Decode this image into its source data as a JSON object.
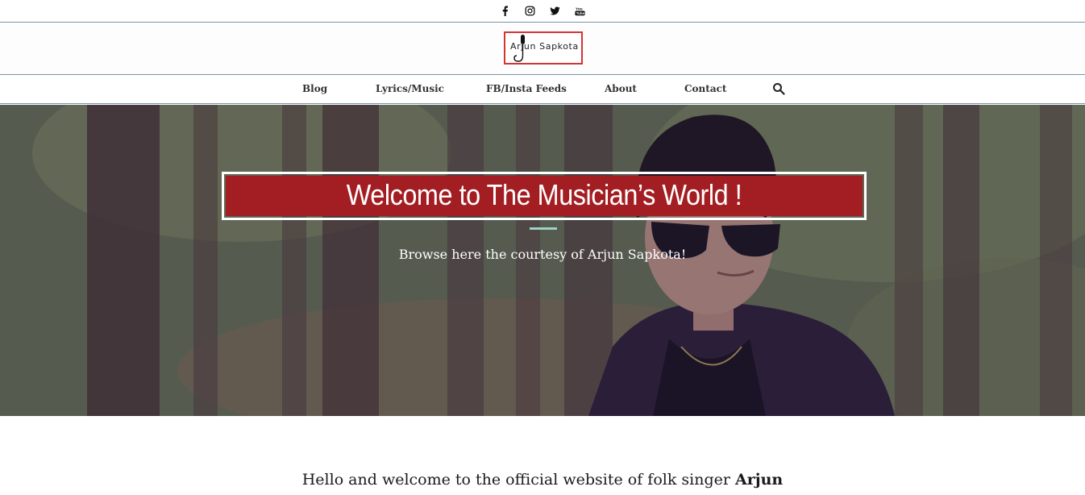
{
  "social": {
    "icons": [
      "facebook-icon",
      "instagram-icon",
      "twitter-icon",
      "youtube-icon"
    ]
  },
  "logo": {
    "text": "Arjun Sapkota",
    "border_color": "#d33434"
  },
  "nav": {
    "items": [
      {
        "label": "Blog"
      },
      {
        "label": "Lyrics/Music"
      },
      {
        "label": "FB/Insta Feeds"
      },
      {
        "label": "About"
      },
      {
        "label": "Contact"
      }
    ],
    "search_icon": "search-icon"
  },
  "hero": {
    "title": "Welcome to The Musician’s World !",
    "subtitle": "Browse here the courtesy of Arjun Sapkota!",
    "title_bg_color": "#a31e22",
    "divider_color": "#9fd0c6"
  },
  "intro": {
    "text": "Hello and welcome to the official website of folk singer ",
    "bold": "Arjun"
  }
}
